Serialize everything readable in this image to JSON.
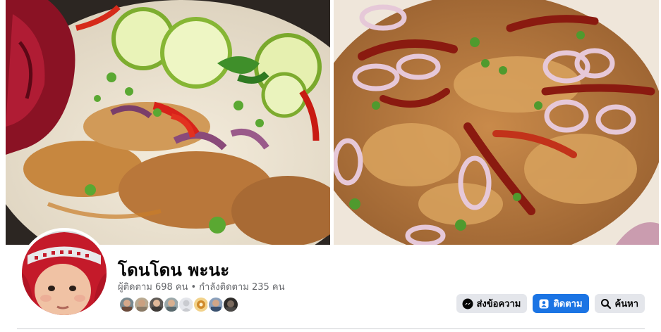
{
  "profile": {
    "name": "โดนโดน พะนะ",
    "followers": "ผู้ติดตาม 698 คน",
    "separator": "•",
    "following": "กำลังติดตาม 235 คน"
  },
  "friends": [
    {
      "icon": "friend-avatar-1",
      "color": "#6b4a3a"
    },
    {
      "icon": "friend-avatar-2",
      "color": "#8a7a66"
    },
    {
      "icon": "friend-avatar-3",
      "color": "#3e3a36"
    },
    {
      "icon": "friend-avatar-4",
      "color": "#5a6a6e"
    },
    {
      "icon": "friend-avatar-5",
      "color": "#c9cbd0"
    },
    {
      "icon": "friend-avatar-6",
      "color": "#d08a2a"
    },
    {
      "icon": "friend-avatar-7",
      "color": "#39506e"
    },
    {
      "icon": "friend-avatar-8",
      "color": "#4a4846"
    }
  ],
  "actions": {
    "message_label": "ส่งข้อความ",
    "follow_label": "ติดตาม",
    "search_label": "ค้นหา"
  },
  "colors": {
    "primary": "#1b74e4",
    "button_grey": "#e4e6eb",
    "text_primary": "#050505",
    "text_secondary": "#65676b"
  }
}
